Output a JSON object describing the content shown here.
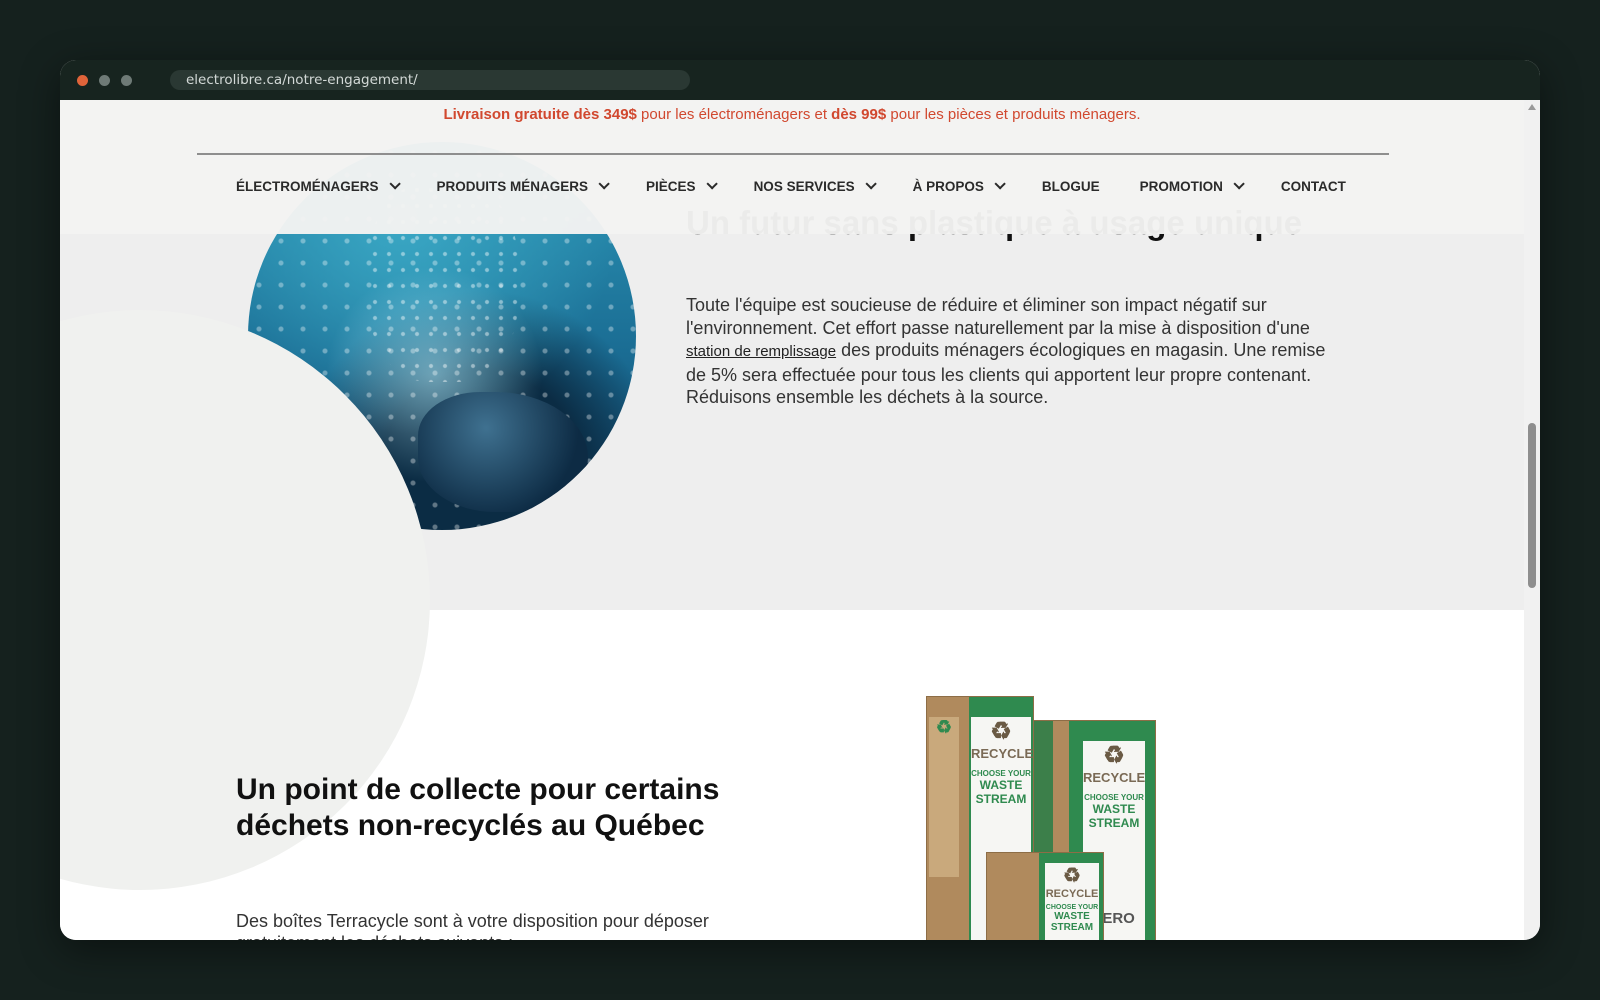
{
  "browser": {
    "url": "electrolibre.ca/notre-engagement/"
  },
  "promo": {
    "part1_bold": "Livraison gratuite dès 349$",
    "part2": " pour les électroménagers et ",
    "part3_bold": "dès 99$",
    "part4": " pour les pièces et produits ménagers."
  },
  "nav": {
    "items": [
      {
        "label": "ÉLECTROMÉNAGERS",
        "has_dropdown": true
      },
      {
        "label": "PRODUITS MÉNAGERS",
        "has_dropdown": true
      },
      {
        "label": "PIÈCES",
        "has_dropdown": true
      },
      {
        "label": "NOS SERVICES",
        "has_dropdown": true
      },
      {
        "label": "À PROPOS",
        "has_dropdown": true
      },
      {
        "label": "BLOGUE",
        "has_dropdown": false
      },
      {
        "label": "PROMOTION",
        "has_dropdown": true
      },
      {
        "label": "CONTACT",
        "has_dropdown": false
      }
    ]
  },
  "section1": {
    "title": "Un futur sans plastique à usage unique",
    "text_before_link": "Toute l'équipe est soucieuse de réduire et éliminer son impact négatif sur l'environnement. Cet effort passe naturellement par la mise à disposition d'une ",
    "link": "station de remplissage",
    "text_after_link": " des produits ménagers écologiques en magasin. Une remise de 5% sera effectuée pour tous les clients qui apportent leur propre contenant. Réduisons ensemble les déchets à la source."
  },
  "section2": {
    "title": "Un point de collecte pour certains déchets non-recyclés au Québec",
    "text": "Des boîtes Terracycle sont à votre disposition pour déposer gratuitement les déchets suivants :"
  },
  "boxes": {
    "recycle": "RECYCLE",
    "choose_your": "CHOOSE YOUR",
    "waste": "WASTE",
    "stream": "STREAM",
    "zero": "ZERO"
  },
  "colors": {
    "promo": "#d1482f",
    "page_bg": "#15211e",
    "section_gray": "#eeeeee"
  }
}
